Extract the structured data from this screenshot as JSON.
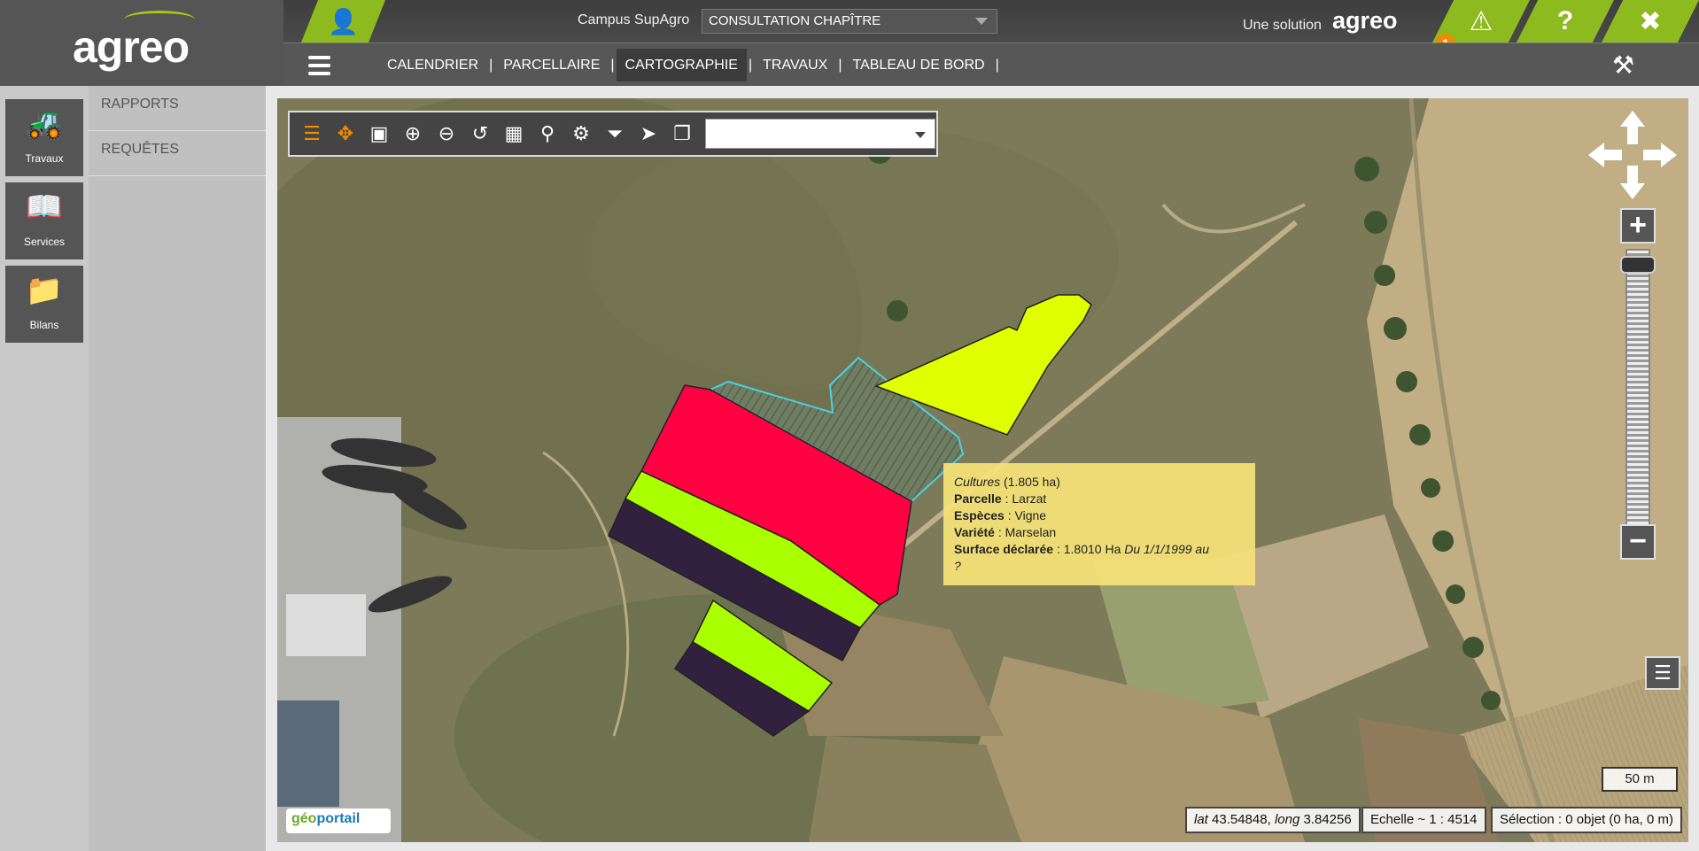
{
  "header": {
    "logo_text": "agreo",
    "campus": "Campus SupAgro",
    "mode_select_value": "CONSULTATION CHAPÎTRE",
    "solution_label": "Une solution",
    "solution_brand": "agreo",
    "alert_count": "1",
    "accent_color": "#8dba1e"
  },
  "nav": {
    "items": [
      "CALENDRIER",
      "PARCELLAIRE",
      "CARTOGRAPHIE",
      "TRAVAUX",
      "TABLEAU DE BORD"
    ],
    "active": "CARTOGRAPHIE"
  },
  "sidebar": {
    "buttons": [
      {
        "label": "Travaux",
        "icon": "tractor-icon"
      },
      {
        "label": "Services",
        "icon": "book-icon"
      },
      {
        "label": "Bilans",
        "icon": "folder-icon"
      }
    ]
  },
  "subnav": {
    "items": [
      "RAPPORTS",
      "REQUÊTES"
    ]
  },
  "map": {
    "tooltip": {
      "title": "Cultures",
      "title_area": "(1.805 ha)",
      "parcelle_label": "Parcelle",
      "parcelle_value": "Larzat",
      "especes_label": "Espèces",
      "especes_value": "Vigne",
      "variete_label": "Variété",
      "variete_value": "Marselan",
      "surface_label": "Surface déclarée",
      "surface_value": "1.8010 Ha",
      "surface_period": "Du 1/1/1999 au",
      "surface_end": "?"
    },
    "scale_label": "50 m",
    "coords": {
      "lat_label": "lat",
      "lat": "43.54848",
      "long_label": "long",
      "long": "3.84256"
    },
    "echelle": "Echelle ~ 1 : 4514",
    "selection": "Sélection : 0 objet (0 ha, 0 m)",
    "attribution_a": "géo",
    "attribution_b": "portail",
    "parcel_colors": {
      "red": "#ff0040",
      "yellow": "#e0ff00",
      "lime": "#aaff00",
      "purple": "#32203f"
    }
  }
}
